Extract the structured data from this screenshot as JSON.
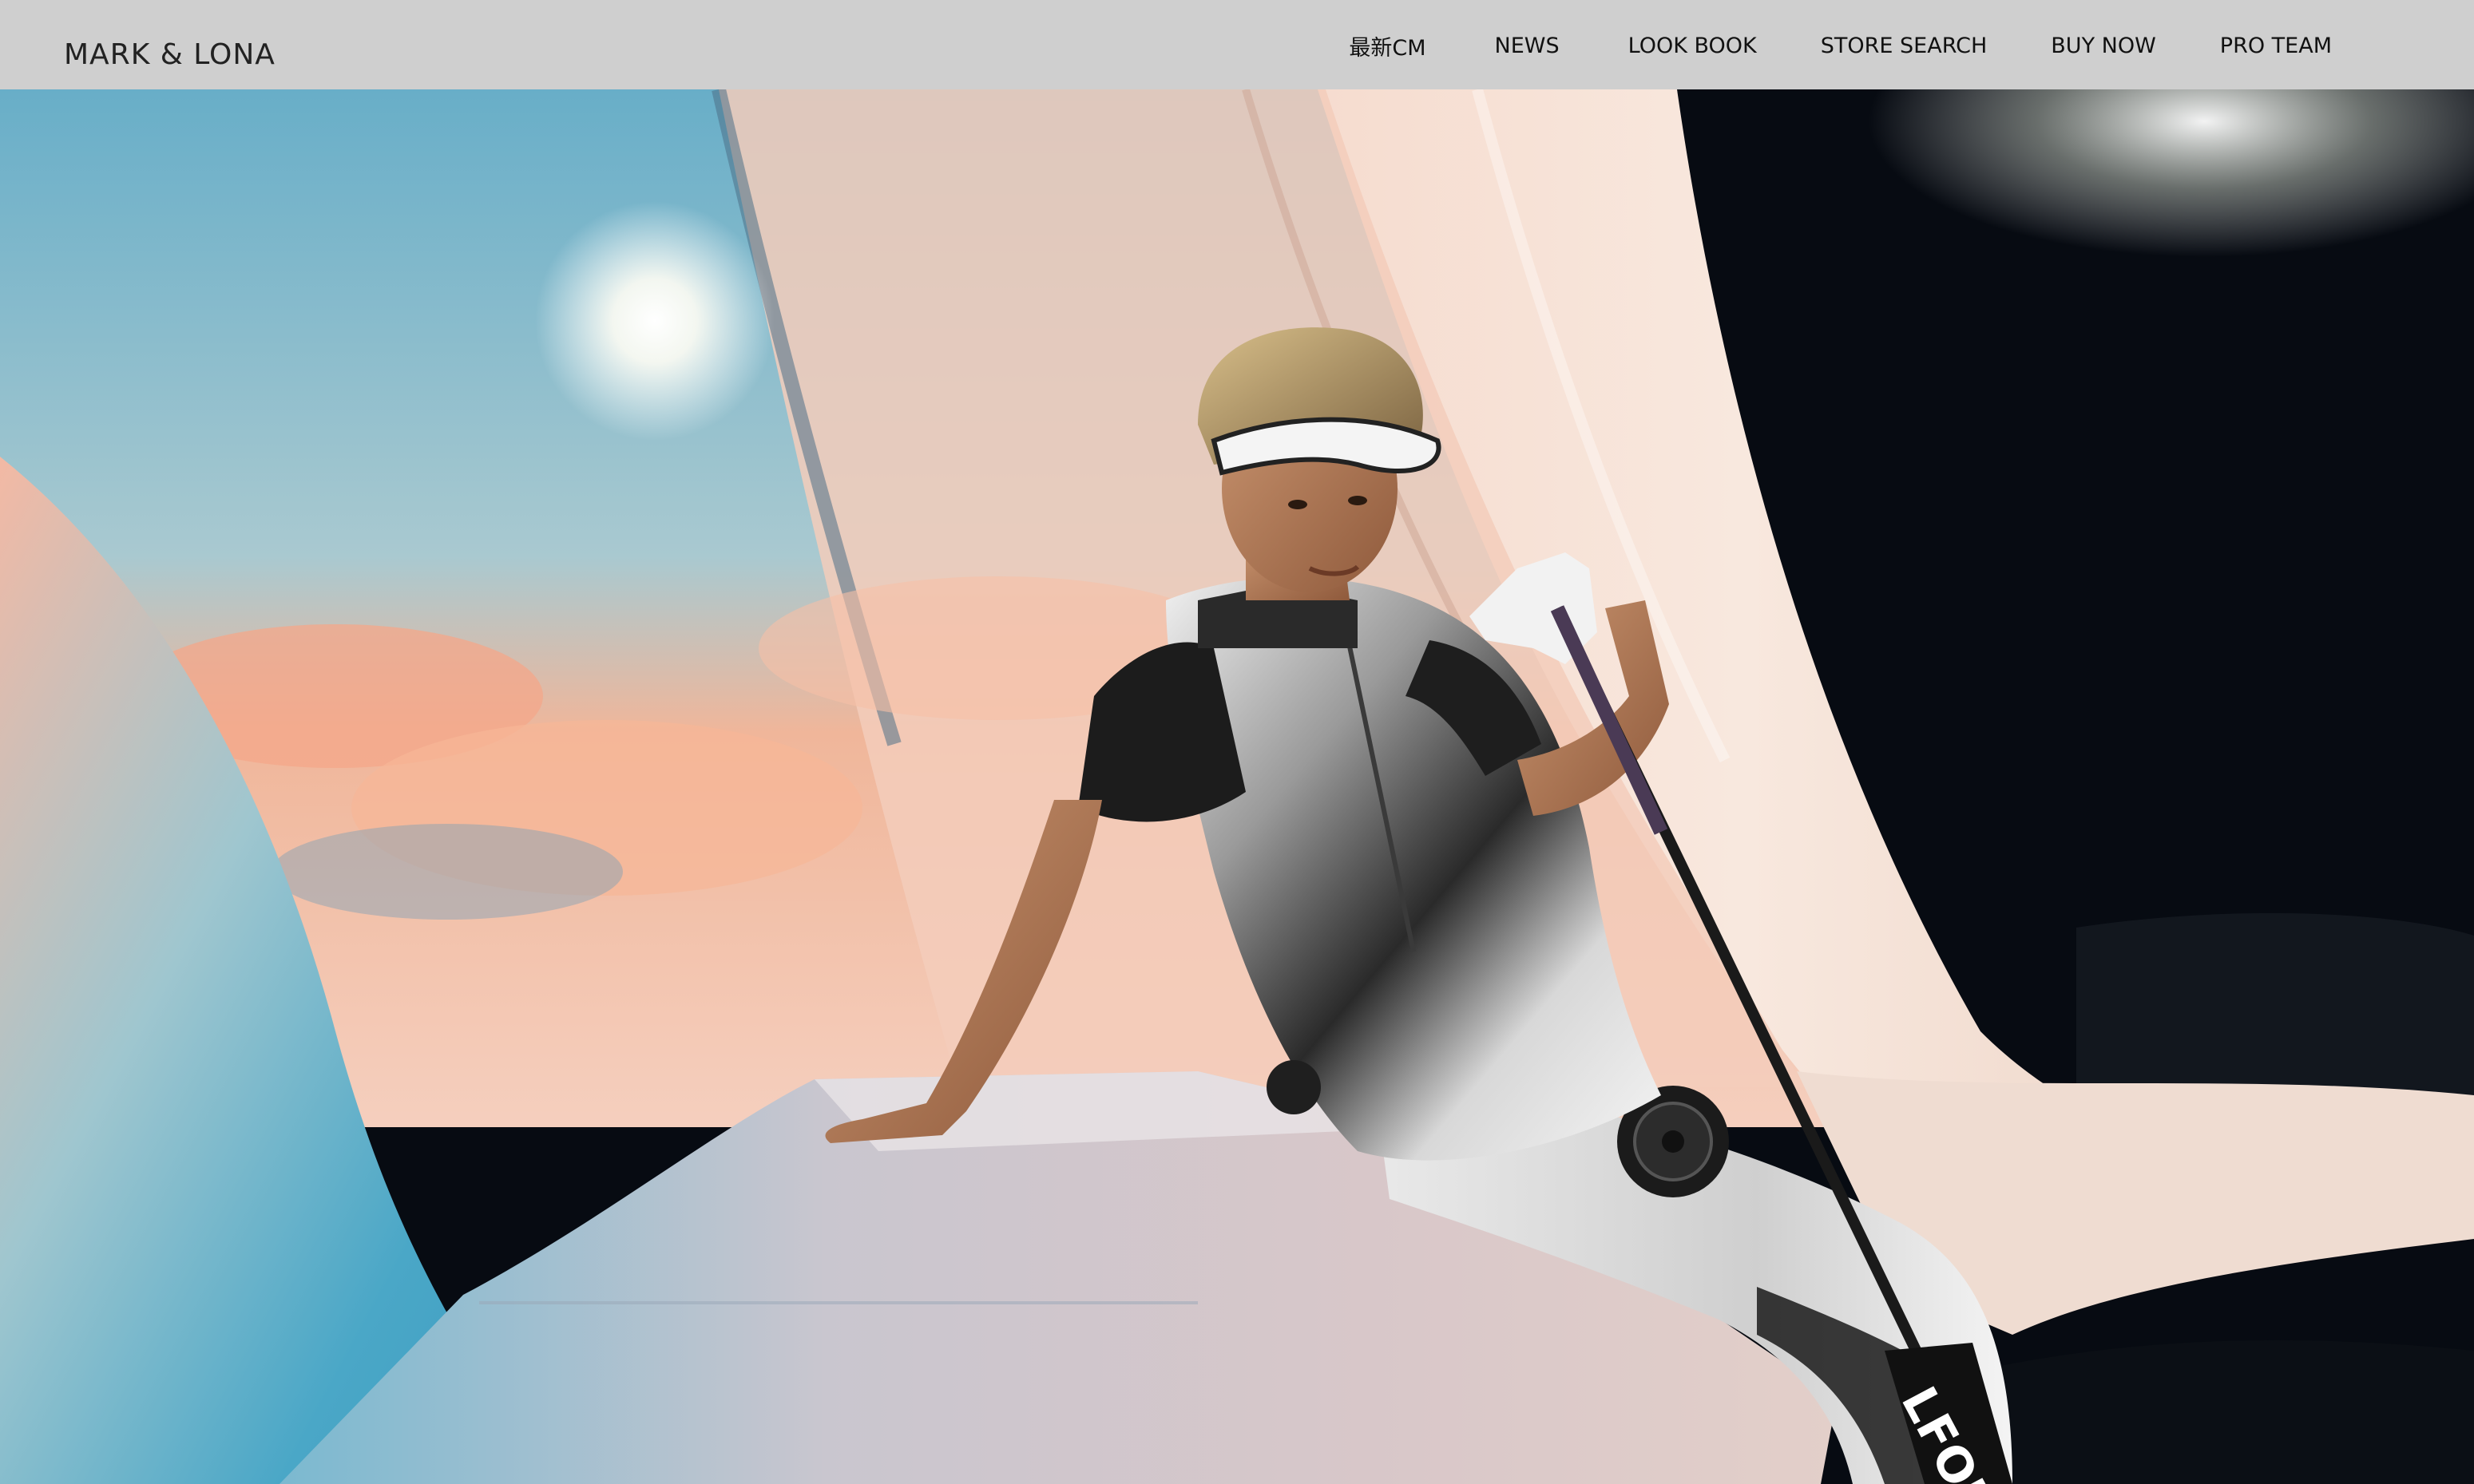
{
  "brand": {
    "logo_text": "MARK & LONA"
  },
  "nav": {
    "items": [
      {
        "label": "最新CM"
      },
      {
        "label": "NEWS"
      },
      {
        "label": "LOOK BOOK"
      },
      {
        "label": "STORE SEARCH"
      },
      {
        "label": "BUY NOW"
      },
      {
        "label": "PRO TEAM"
      }
    ]
  },
  "colors": {
    "header_bg": "#cfcfcf",
    "nav_text": "#111111",
    "logo_text": "#222222"
  },
  "hero": {
    "icon": "hero-photo"
  }
}
